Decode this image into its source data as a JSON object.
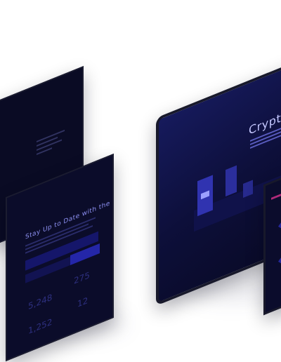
{
  "devices": {
    "left_back": {
      "text": []
    },
    "left_front": {
      "eyebrow": "",
      "heading": "Stay Up to Date with the Latest",
      "stats": [
        "5,248",
        "275",
        "1,252",
        "12"
      ]
    },
    "right_main": {
      "heading": "Cryptoc"
    }
  },
  "colors": {
    "page": "#ffffff",
    "device_bg": "#0a0b24",
    "accent": "#2a2cc0",
    "heading": "#8c8ff0"
  }
}
